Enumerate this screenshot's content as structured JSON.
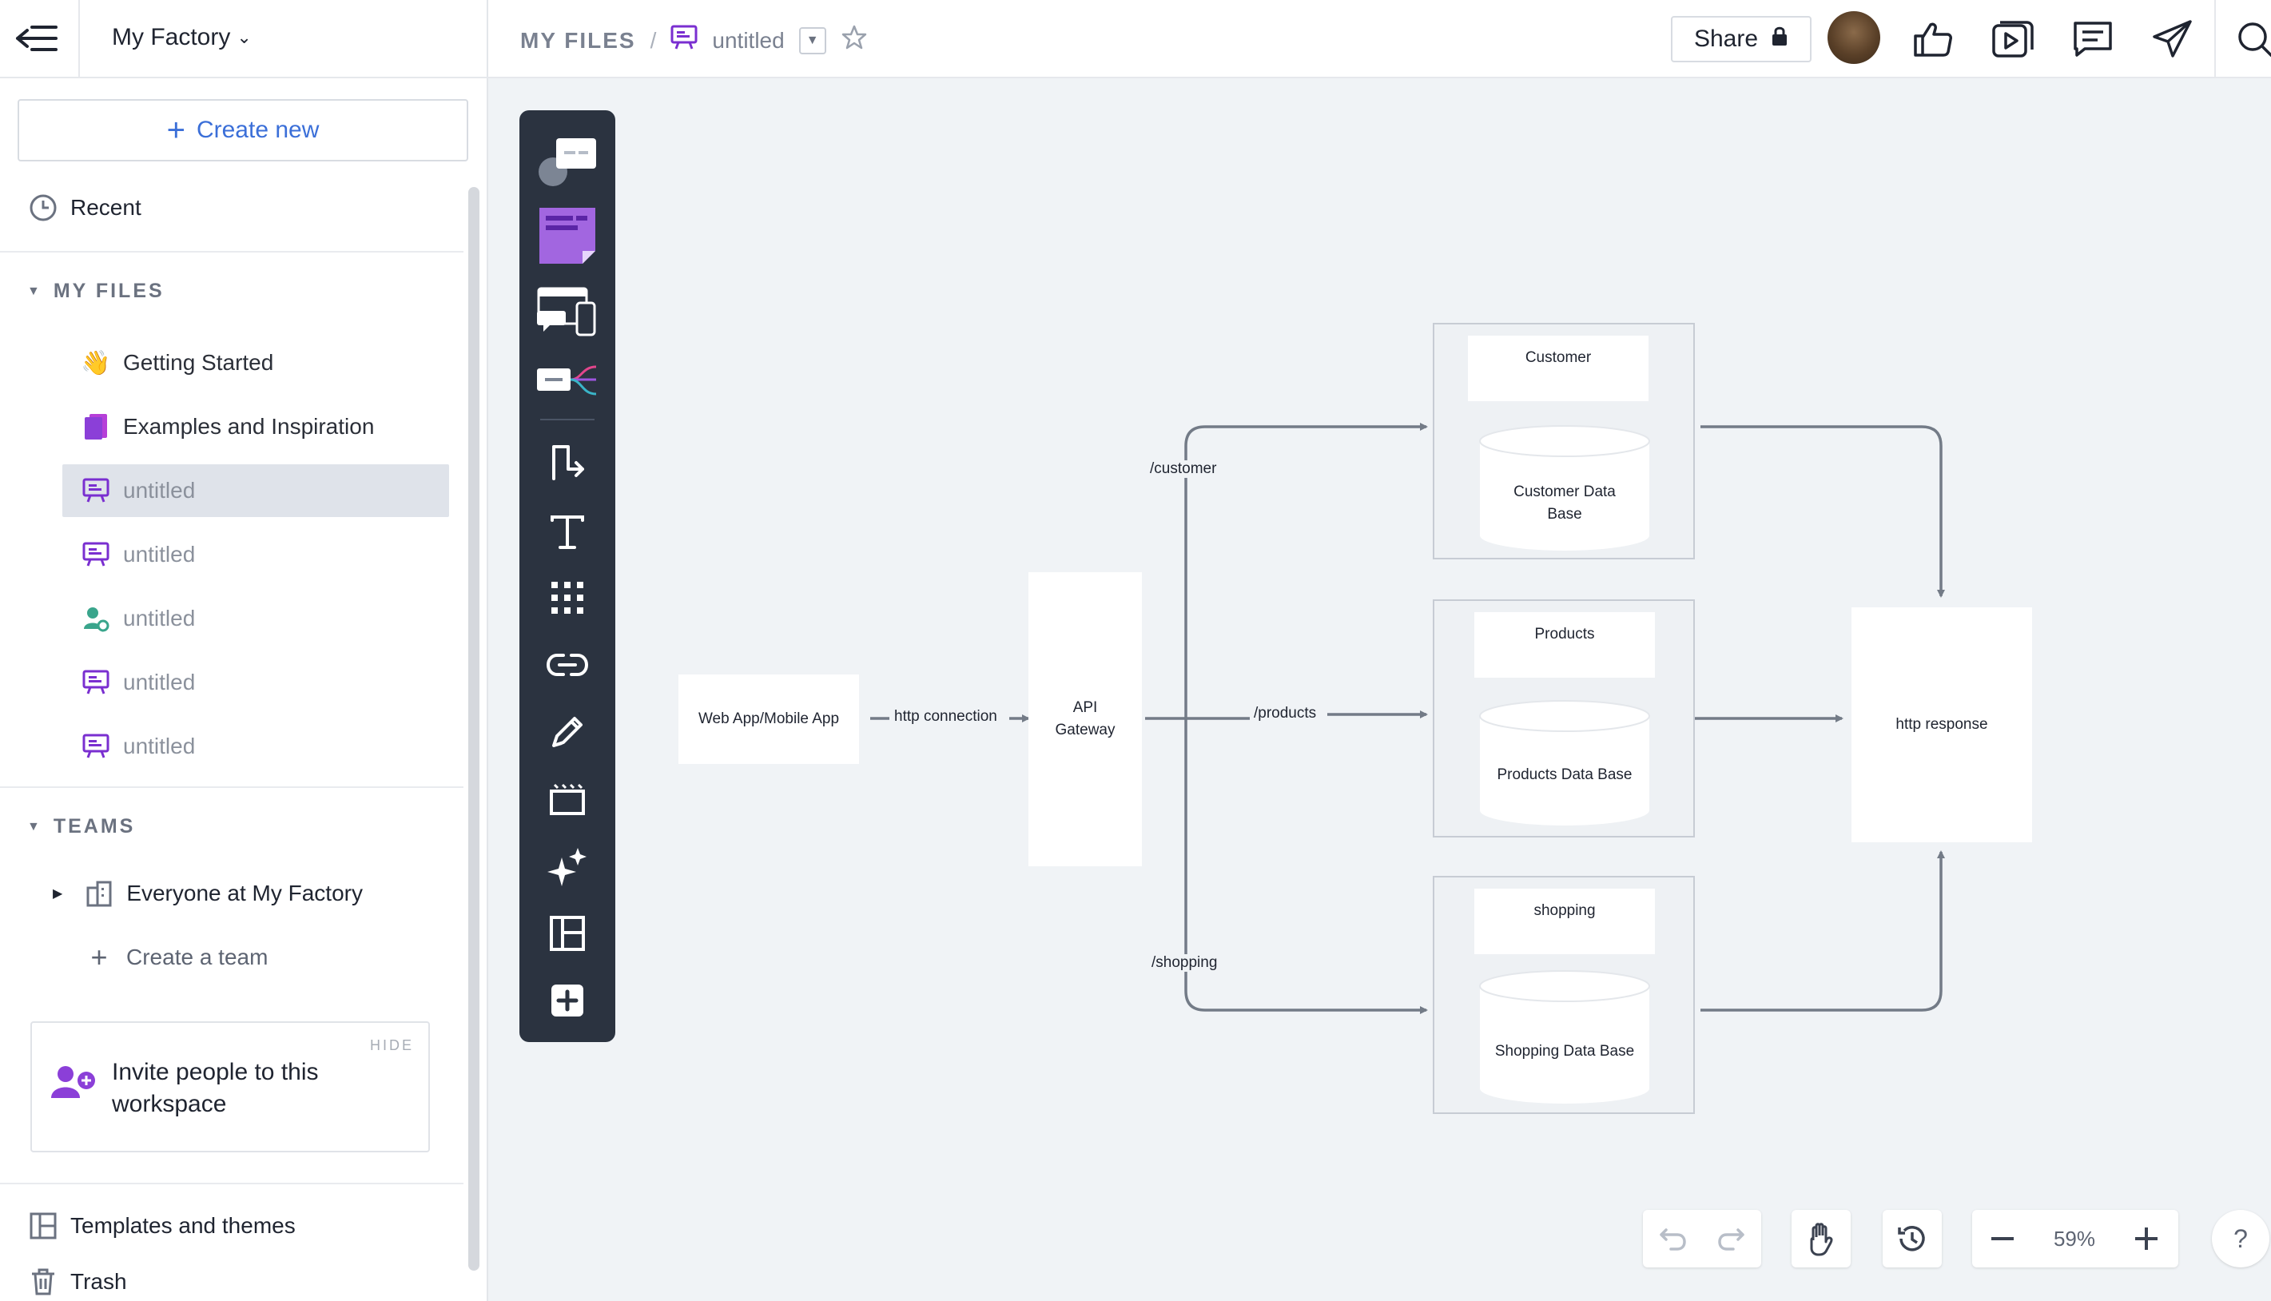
{
  "colors": {
    "accent": "#3b6fd8",
    "purple": "#8b3fd8",
    "toolbar": "#2b3340",
    "teal": "#3aa58c"
  },
  "sidebar": {
    "workspace": "My Factory",
    "create_new": "Create new",
    "recent": "Recent",
    "my_files_title": "MY FILES",
    "files": [
      {
        "label": "Getting Started",
        "icon": "waving-hand-icon"
      },
      {
        "label": "Examples and Inspiration",
        "icon": "book-icon"
      },
      {
        "label": "untitled",
        "icon": "whiteboard-icon"
      },
      {
        "label": "untitled",
        "icon": "whiteboard-icon"
      },
      {
        "label": "untitled",
        "icon": "user-flow-icon"
      },
      {
        "label": "untitled",
        "icon": "whiteboard-icon"
      },
      {
        "label": "untitled",
        "icon": "whiteboard-icon"
      }
    ],
    "teams_title": "TEAMS",
    "team": "Everyone at My Factory",
    "create_team": "Create a team",
    "invite_hide": "HIDE",
    "invite_text": "Invite people to this workspace",
    "templates": "Templates and themes",
    "trash": "Trash"
  },
  "topbar": {
    "root": "MY FILES",
    "separator": "/",
    "doc_title": "untitled",
    "share": "Share"
  },
  "diagram": {
    "client": "Web App/Mobile App",
    "edge_http": "http connection",
    "gateway_line1": "API",
    "gateway_line2": "Gateway",
    "route_customer": "/customer",
    "route_products": "/products",
    "route_shopping": "/shopping",
    "customer": "Customer",
    "customer_db": "Customer Data Base",
    "products": "Products",
    "products_db": "Products Data Base",
    "shopping": "shopping",
    "shopping_db": "Shopping Data Base",
    "response": "http  response"
  },
  "controls": {
    "zoom": "59%",
    "help": "?"
  }
}
